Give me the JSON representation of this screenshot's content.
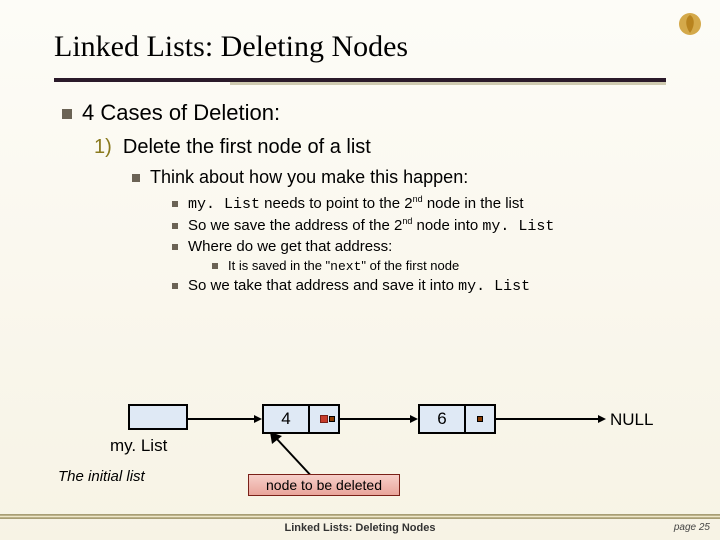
{
  "title": "Linked Lists:  Deleting Nodes",
  "cases_heading": "4 Cases of Deletion:",
  "case1_num": "1)",
  "case1_text": "Delete the first node of a list",
  "think": "Think about how you make this happen:",
  "p1_a": "my. List",
  "p1_b": " needs to point to the 2",
  "p1_c": " node in the list",
  "nd": "nd",
  "p2_a": "So we save the address of the 2",
  "p2_b": " node into ",
  "p2_c": "my. List",
  "p3": "Where do we get that address:",
  "p4_a": "It is saved in the \"",
  "p4_b": "next",
  "p4_c": "\" of the first node",
  "p5_a": "So we take that address and save it into ",
  "p5_b": "my. List",
  "diagram": {
    "mylist": "my. List",
    "val1": "4",
    "val2": "6",
    "null": "NULL",
    "initial": "The initial list",
    "delete": "node to be deleted"
  },
  "footer": {
    "title": "Linked Lists: Deleting Nodes",
    "page": "page 25"
  }
}
